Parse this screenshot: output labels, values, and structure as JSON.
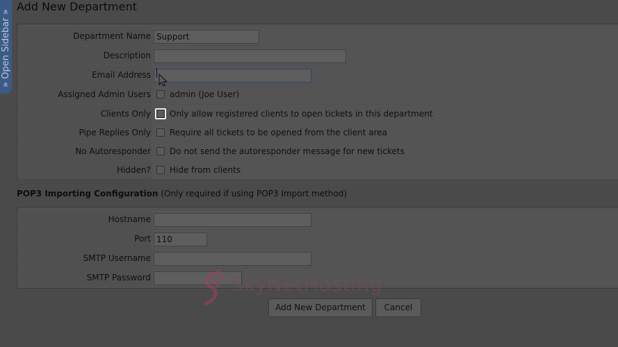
{
  "sidebar": {
    "label": "» Open Sidebar »"
  },
  "page": {
    "title": "Add New Department"
  },
  "form": {
    "department_name": {
      "label": "Department Name",
      "value": "Support"
    },
    "description": {
      "label": "Description",
      "value": ""
    },
    "email_address": {
      "label": "Email Address",
      "value": ""
    },
    "assigned_admin_users": {
      "label": "Assigned Admin Users",
      "option": "admin (Joe User)"
    },
    "clients_only": {
      "label": "Clients Only",
      "option": "Only allow registered clients to open tickets in this department"
    },
    "pipe_replies_only": {
      "label": "Pipe Replies Only",
      "option": "Require all tickets to be opened from the client area"
    },
    "no_autoresponder": {
      "label": "No Autoresponder",
      "option": "Do not send the autoresponder message for new tickets"
    },
    "hidden": {
      "label": "Hidden?",
      "option": "Hide from clients"
    }
  },
  "pop3": {
    "heading": "POP3 Importing Configuration",
    "note": "(Only required if using POP3 Import method)",
    "hostname": {
      "label": "Hostname",
      "value": ""
    },
    "port": {
      "label": "Port",
      "value": "110"
    },
    "smtp_username": {
      "label": "SMTP Username",
      "value": ""
    },
    "smtp_password": {
      "label": "SMTP Password",
      "value": ""
    }
  },
  "actions": {
    "submit_label": "Add New Department",
    "cancel_label": "Cancel"
  },
  "watermark": {
    "text": "SkyNetHosting"
  },
  "colors": {
    "overlay": "#4a4a4a",
    "sidebar": "#3b5a86",
    "watermark": "#b0476a"
  }
}
